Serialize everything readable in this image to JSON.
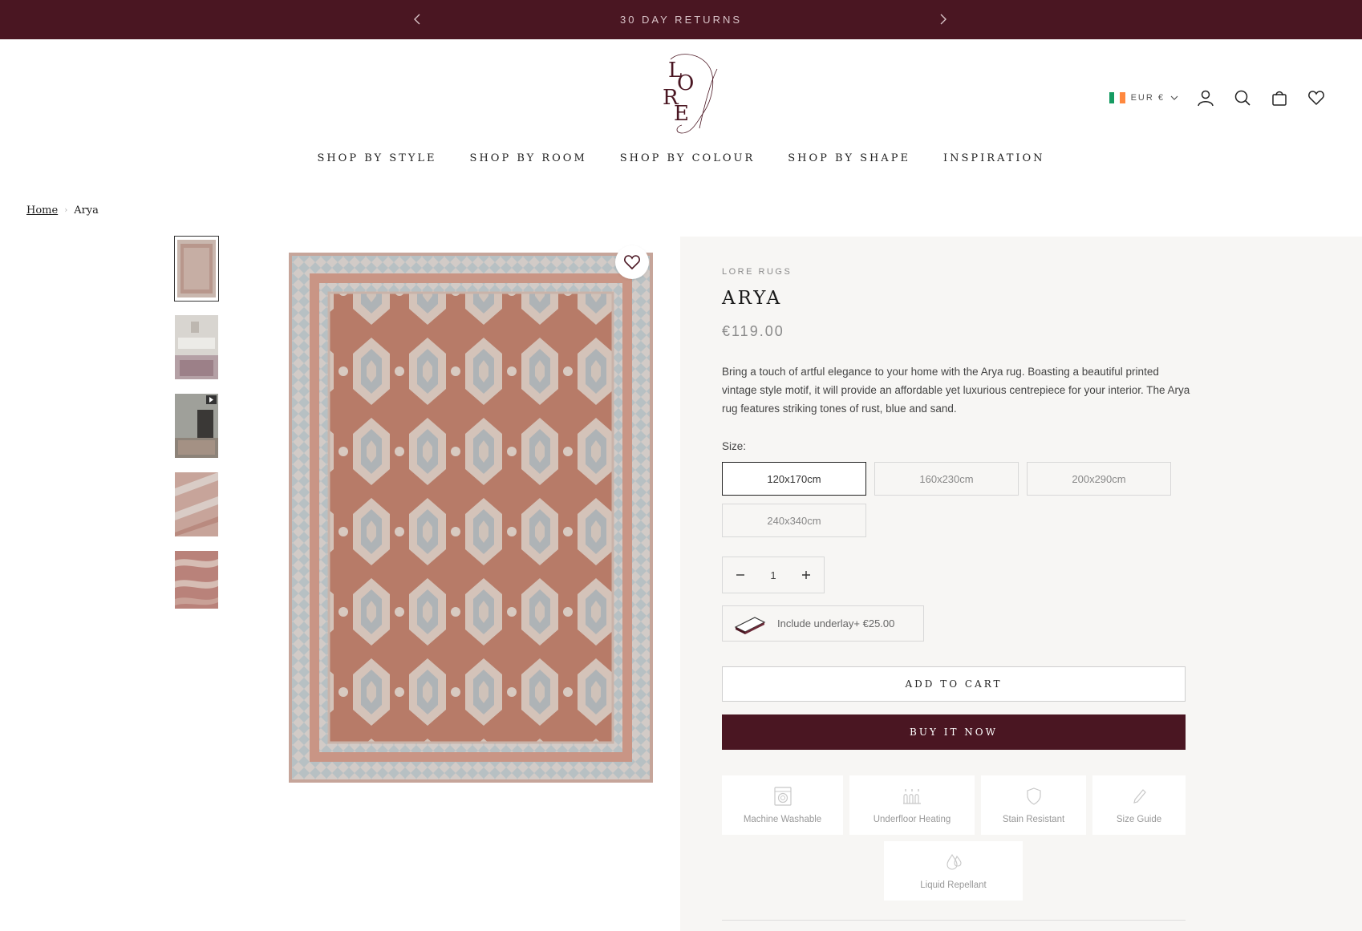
{
  "announcement": {
    "text": "30 DAY RETURNS",
    "bg_color": "#4a1622"
  },
  "header": {
    "logo_alt": "LORE",
    "currency": {
      "label": "EUR €",
      "flag": "ireland-flag"
    },
    "icons": [
      "account-icon",
      "search-icon",
      "cart-icon",
      "wishlist-icon"
    ]
  },
  "nav": {
    "items": [
      {
        "label": "SHOP BY STYLE"
      },
      {
        "label": "SHOP BY ROOM"
      },
      {
        "label": "SHOP BY COLOUR"
      },
      {
        "label": "SHOP BY SHAPE"
      },
      {
        "label": "INSPIRATION"
      }
    ]
  },
  "breadcrumb": {
    "home": "Home",
    "current": "Arya"
  },
  "gallery": {
    "thumbnails": [
      {
        "name": "rug-front",
        "active": true
      },
      {
        "name": "room-scene",
        "active": false
      },
      {
        "name": "video",
        "active": false,
        "has_video": true
      },
      {
        "name": "detail-close",
        "active": false
      },
      {
        "name": "texture-close",
        "active": false
      }
    ]
  },
  "product": {
    "vendor": "LORE RUGS",
    "title": "ARYA",
    "price": "€119.00",
    "description": "Bring a touch of artful elegance to your home with the Arya rug. Boasting a beautiful printed vintage style motif, it will provide an affordable yet luxurious centrepiece for your interior. The Arya rug features striking tones of rust, blue and sand.",
    "size_label": "Size:",
    "sizes": [
      {
        "label": "120x170cm",
        "selected": true
      },
      {
        "label": "160x230cm",
        "selected": false
      },
      {
        "label": "200x290cm",
        "selected": false
      },
      {
        "label": "240x340cm",
        "selected": false
      }
    ],
    "quantity": "1",
    "underlay": "Include underlay+ €25.00",
    "add_to_cart": "ADD TO CART",
    "buy_now": "BUY IT NOW",
    "features": [
      {
        "label": "Machine Washable",
        "icon": "washing-machine-icon"
      },
      {
        "label": "Underfloor Heating",
        "icon": "heating-icon"
      },
      {
        "label": "Stain Resistant",
        "icon": "shield-icon"
      },
      {
        "label": "Size Guide",
        "icon": "pencil-icon"
      },
      {
        "label": "Liquid Repellant",
        "icon": "droplet-icon"
      }
    ],
    "accent_color": "#4a1622",
    "panel_bg": "#f7f6f4"
  }
}
